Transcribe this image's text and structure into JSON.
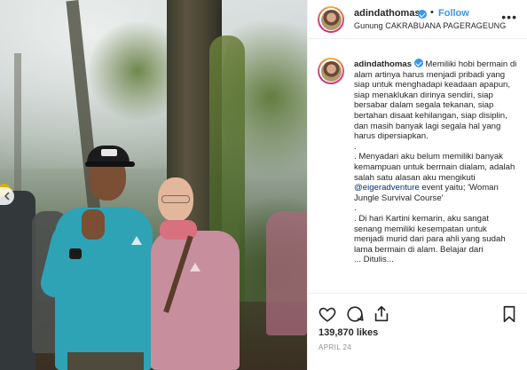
{
  "post": {
    "username": "adindathomas",
    "follow_label": "Follow",
    "separator": "•",
    "location": "Gunung CAKRABUANA PAGERAGEUNG",
    "more_label": "•••"
  },
  "caption": {
    "username": "adindathomas",
    "p1": "Memiliki hobi bermain di alam artinya harus menjadi pribadi yang siap untuk menghadapi keadaan apapun, siap menaklukan dirinya sendiri, siap bersabar dalam segala tekanan, siap bertahan disaat kehilangan, siap disiplin, dan masih banyak lagi segala hal yang harus dipersiapkan.",
    "sep1": ".",
    "p2_before": ". Menyadari aku belum memiliki banyak kemampuan untuk bermain dialam, adalah salah satu alasan aku mengikuti ",
    "p2_mention": "@eigeradventure",
    "p2_after": " event yaitu; 'Woman Jungle Survival Course'",
    "sep2": ".",
    "p3": ". Di hari Kartini kemarin, aku sangat senang memiliki kesempatan untuk menjadi murid dari para ahli yang sudah lama bermain di alam. Belajar dari",
    "p4": "... Ditulis..."
  },
  "footer": {
    "likes": "139,870 likes",
    "date": "APRIL 24"
  },
  "icons": {
    "like": "heart-outline-icon",
    "comment": "speech-bubble-icon",
    "share": "share-upload-icon",
    "save": "bookmark-icon",
    "verified": "verified-badge-icon",
    "prev": "chevron-left-icon"
  },
  "colors": {
    "accent": "#3897f0",
    "text": "#262626",
    "muted": "#8e8e8e",
    "divider": "#efefef"
  }
}
